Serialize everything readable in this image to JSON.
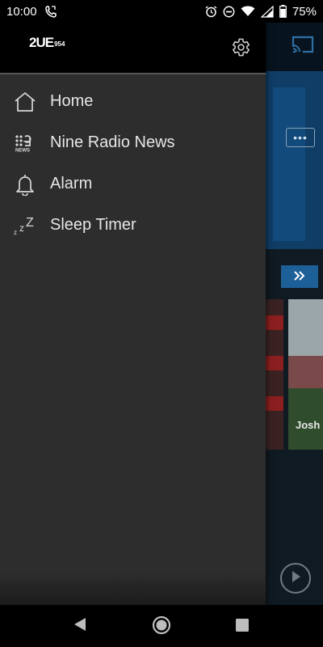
{
  "status_bar": {
    "time": "10:00",
    "battery_percent": "75%",
    "icons": [
      "call-forward-icon",
      "alarm-icon",
      "do-not-disturb-icon",
      "wifi-icon",
      "signal-icon",
      "battery-icon"
    ]
  },
  "drawer": {
    "logo": {
      "main": "2UE",
      "freq": "954"
    },
    "settings_icon": "gear-icon",
    "items": [
      {
        "label": "Home",
        "icon": "home-icon"
      },
      {
        "label": "Nine Radio News",
        "icon": "nine-news-icon"
      },
      {
        "label": "Alarm",
        "icon": "bell-icon"
      },
      {
        "label": "Sleep Timer",
        "icon": "sleep-zzz-icon"
      }
    ]
  },
  "background": {
    "thumbnail_caption": "Josh",
    "colors": {
      "hero": "#0f3d66",
      "accent_button": "#1d5f97"
    }
  },
  "nav_bar": {
    "icons": [
      "back-icon",
      "home-circle-icon",
      "recents-square-icon"
    ]
  },
  "colors": {
    "drawer_bg": "#2d2d2d",
    "drawer_header_bg": "#000000",
    "menu_text": "#e6e6e6"
  }
}
